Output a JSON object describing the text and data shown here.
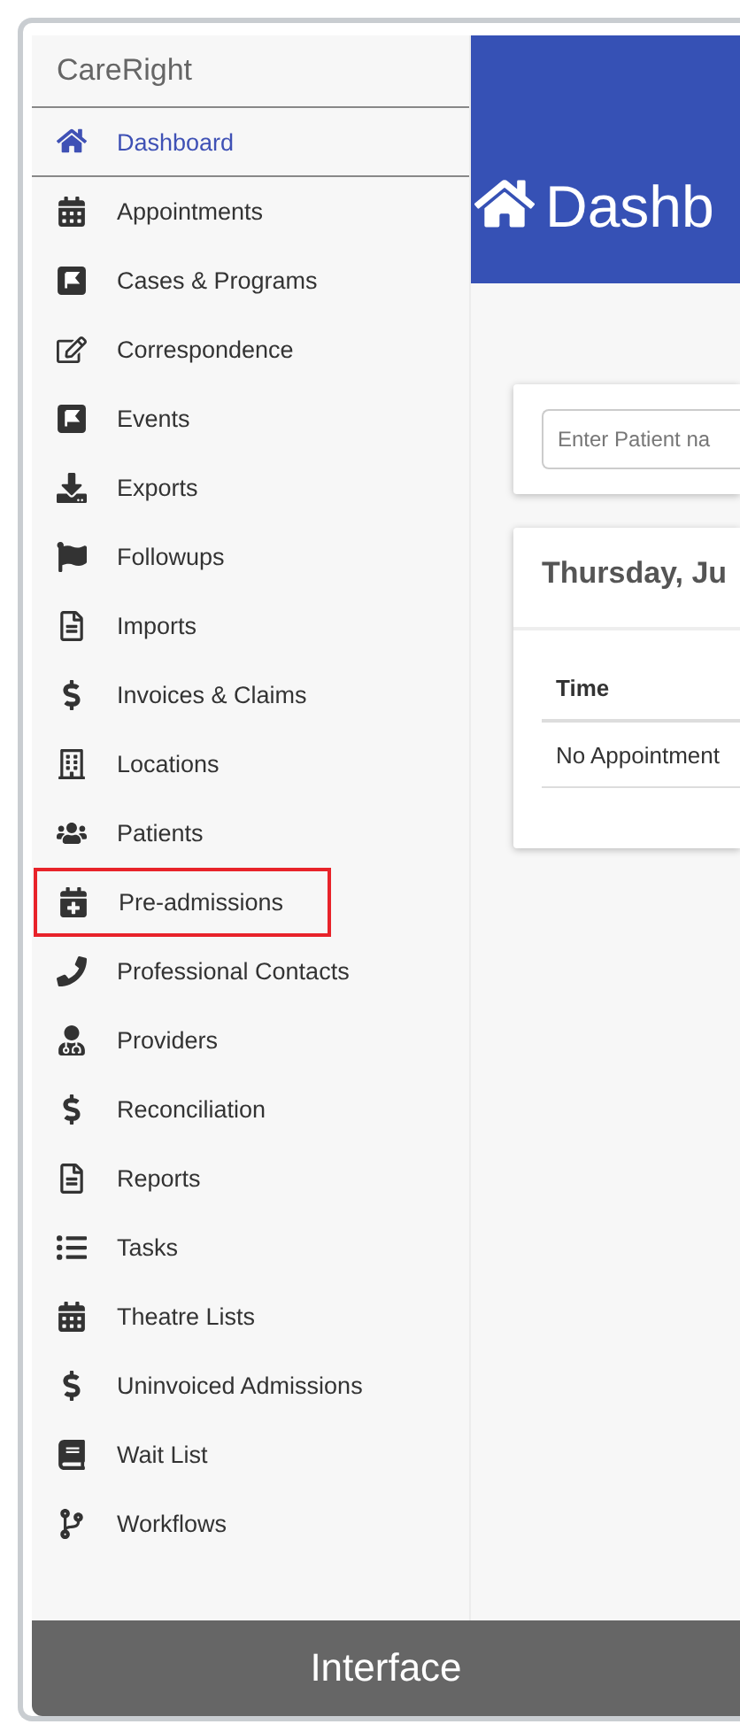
{
  "sidebar": {
    "brand": "CareRight",
    "items": [
      {
        "label": "Dashboard",
        "selected": true,
        "highlighted": false
      },
      {
        "label": "Appointments",
        "selected": false,
        "highlighted": false
      },
      {
        "label": "Cases & Programs",
        "selected": false,
        "highlighted": false
      },
      {
        "label": "Correspondence",
        "selected": false,
        "highlighted": false
      },
      {
        "label": "Events",
        "selected": false,
        "highlighted": false
      },
      {
        "label": "Exports",
        "selected": false,
        "highlighted": false
      },
      {
        "label": "Followups",
        "selected": false,
        "highlighted": false
      },
      {
        "label": "Imports",
        "selected": false,
        "highlighted": false
      },
      {
        "label": "Invoices & Claims",
        "selected": false,
        "highlighted": false
      },
      {
        "label": "Locations",
        "selected": false,
        "highlighted": false
      },
      {
        "label": "Patients",
        "selected": false,
        "highlighted": false
      },
      {
        "label": "Pre-admissions",
        "selected": false,
        "highlighted": true
      },
      {
        "label": "Professional Contacts",
        "selected": false,
        "highlighted": false
      },
      {
        "label": "Providers",
        "selected": false,
        "highlighted": false
      },
      {
        "label": "Reconciliation",
        "selected": false,
        "highlighted": false
      },
      {
        "label": "Reports",
        "selected": false,
        "highlighted": false
      },
      {
        "label": "Tasks",
        "selected": false,
        "highlighted": false
      },
      {
        "label": "Theatre Lists",
        "selected": false,
        "highlighted": false
      },
      {
        "label": "Uninvoiced Admissions",
        "selected": false,
        "highlighted": false
      },
      {
        "label": "Wait List",
        "selected": false,
        "highlighted": false
      },
      {
        "label": "Workflows",
        "selected": false,
        "highlighted": false
      }
    ]
  },
  "header": {
    "title": "Dashb"
  },
  "search": {
    "placeholder": "Enter Patient na"
  },
  "appointments": {
    "date": "Thursday, Ju",
    "columns": [
      "Time"
    ],
    "empty": "No Appointment"
  },
  "caption": "Interface"
}
